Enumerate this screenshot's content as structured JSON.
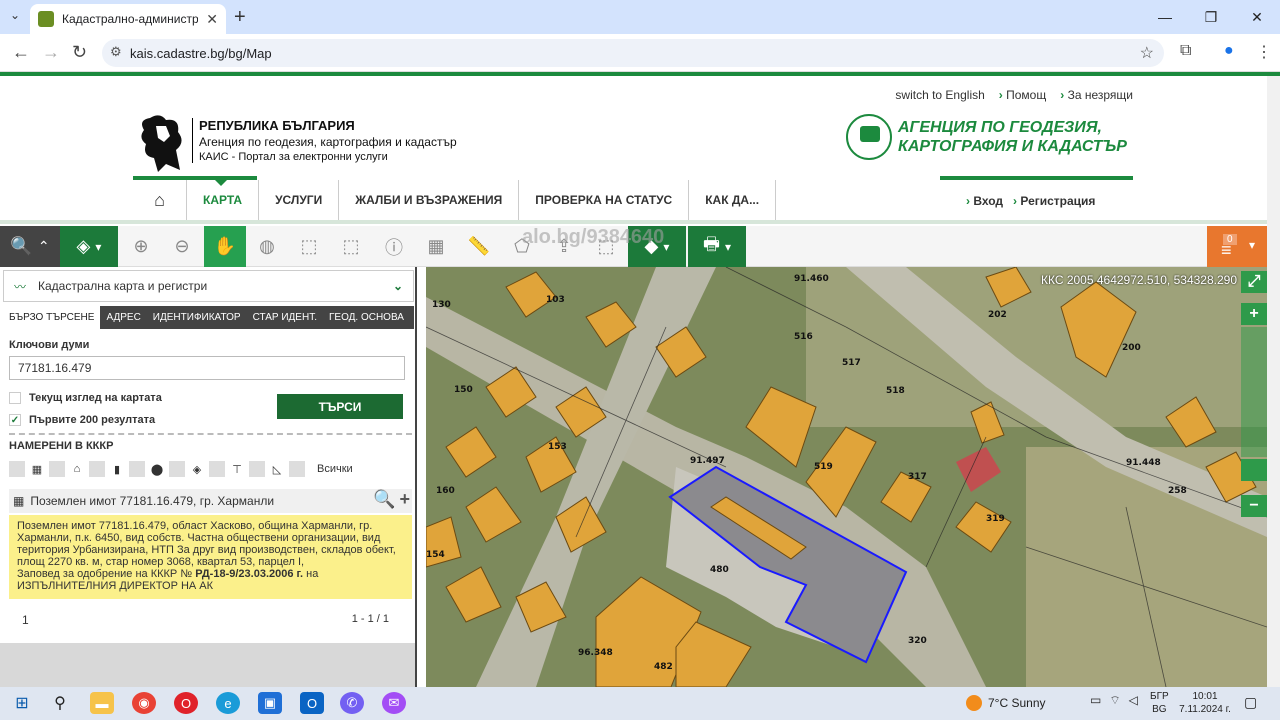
{
  "browser": {
    "tab_title": "Кадастрално-административна",
    "url": "kais.cadastre.bg/bg/Map"
  },
  "site": {
    "top_links": [
      "switch to English",
      "Помощ",
      "За незрящи"
    ],
    "org_line1": "РЕПУБЛИКА БЪЛГАРИЯ",
    "org_line2": "Агенция по геодезия, картография и кадастър",
    "org_line3": "КАИС - Портал за електронни услуги",
    "agency_line1": "АГЕНЦИЯ ПО ГЕОДЕЗИЯ,",
    "agency_line2": "КАРТОГРАФИЯ И КАДАСТЪР",
    "menu": [
      "КАРТА",
      "УСЛУГИ",
      "ЖАЛБИ И ВЪЗРАЖЕНИЯ",
      "ПРОВЕРКА НА СТАТУС",
      "КАК ДА..."
    ],
    "auth": [
      "Вход",
      "Регистрация"
    ]
  },
  "toolbar": {
    "watermark": "alo.bg/9384640",
    "counter": "0"
  },
  "panel": {
    "title": "Кадастрална карта и регистри",
    "tabs": [
      "БЪРЗО ТЪРСЕНЕ",
      "АДРЕС",
      "ИДЕНТИФИКАТОР",
      "СТАР ИДЕНТ.",
      "ГЕОД. ОСНОВА"
    ],
    "keywords_label": "Ключови думи",
    "keywords_value": "77181.16.479",
    "chk_current_view": "Текущ изглед на картата",
    "chk_first200": "Първите 200 резултата",
    "search_button": "ТЪРСИ",
    "found_label": "НАМЕРЕНИ В КККР",
    "filter_all": "Всички",
    "result_title": "Поземлен имот 77181.16.479, гр. Харманли",
    "result_text1": "Поземлен имот 77181.16.479, област Хасково, община Харманли, гр. Харманли, п.к. 6450, вид собств. Частна обществени организации, вид територия Урбанизирана, НТП За друг вид производствен, складов обект, площ 2270 кв. м, стар номер 3068, квартал 53, парцел I,",
    "result_text2": "Заповед за одобрение на КККР №",
    "result_order": "РД-18-9/23.03.2006 г.",
    "result_text3": "на ИЗПЪЛНИТЕЛНИЯ ДИРЕКТОР НА АК",
    "page": "1",
    "count": "1 - 1 / 1"
  },
  "map": {
    "coords": "ККС 2005 4642972.510, 534328.290",
    "parcel_labels": [
      "130",
      "103",
      "150",
      "202",
      "200",
      "516",
      "517",
      "518",
      "519",
      "480",
      "482",
      "320",
      "317",
      "319",
      "258",
      "160",
      "154",
      "153",
      "91.460",
      "91.497",
      "91.448",
      "96.348"
    ],
    "highlight_color": "#1a1aff",
    "building_color": "#e0a43a"
  },
  "taskbar": {
    "weather": "7°C  Sunny",
    "lang_top": "БГР",
    "lang_bottom": "BG",
    "time": "10:01",
    "date": "7.11.2024 г."
  }
}
